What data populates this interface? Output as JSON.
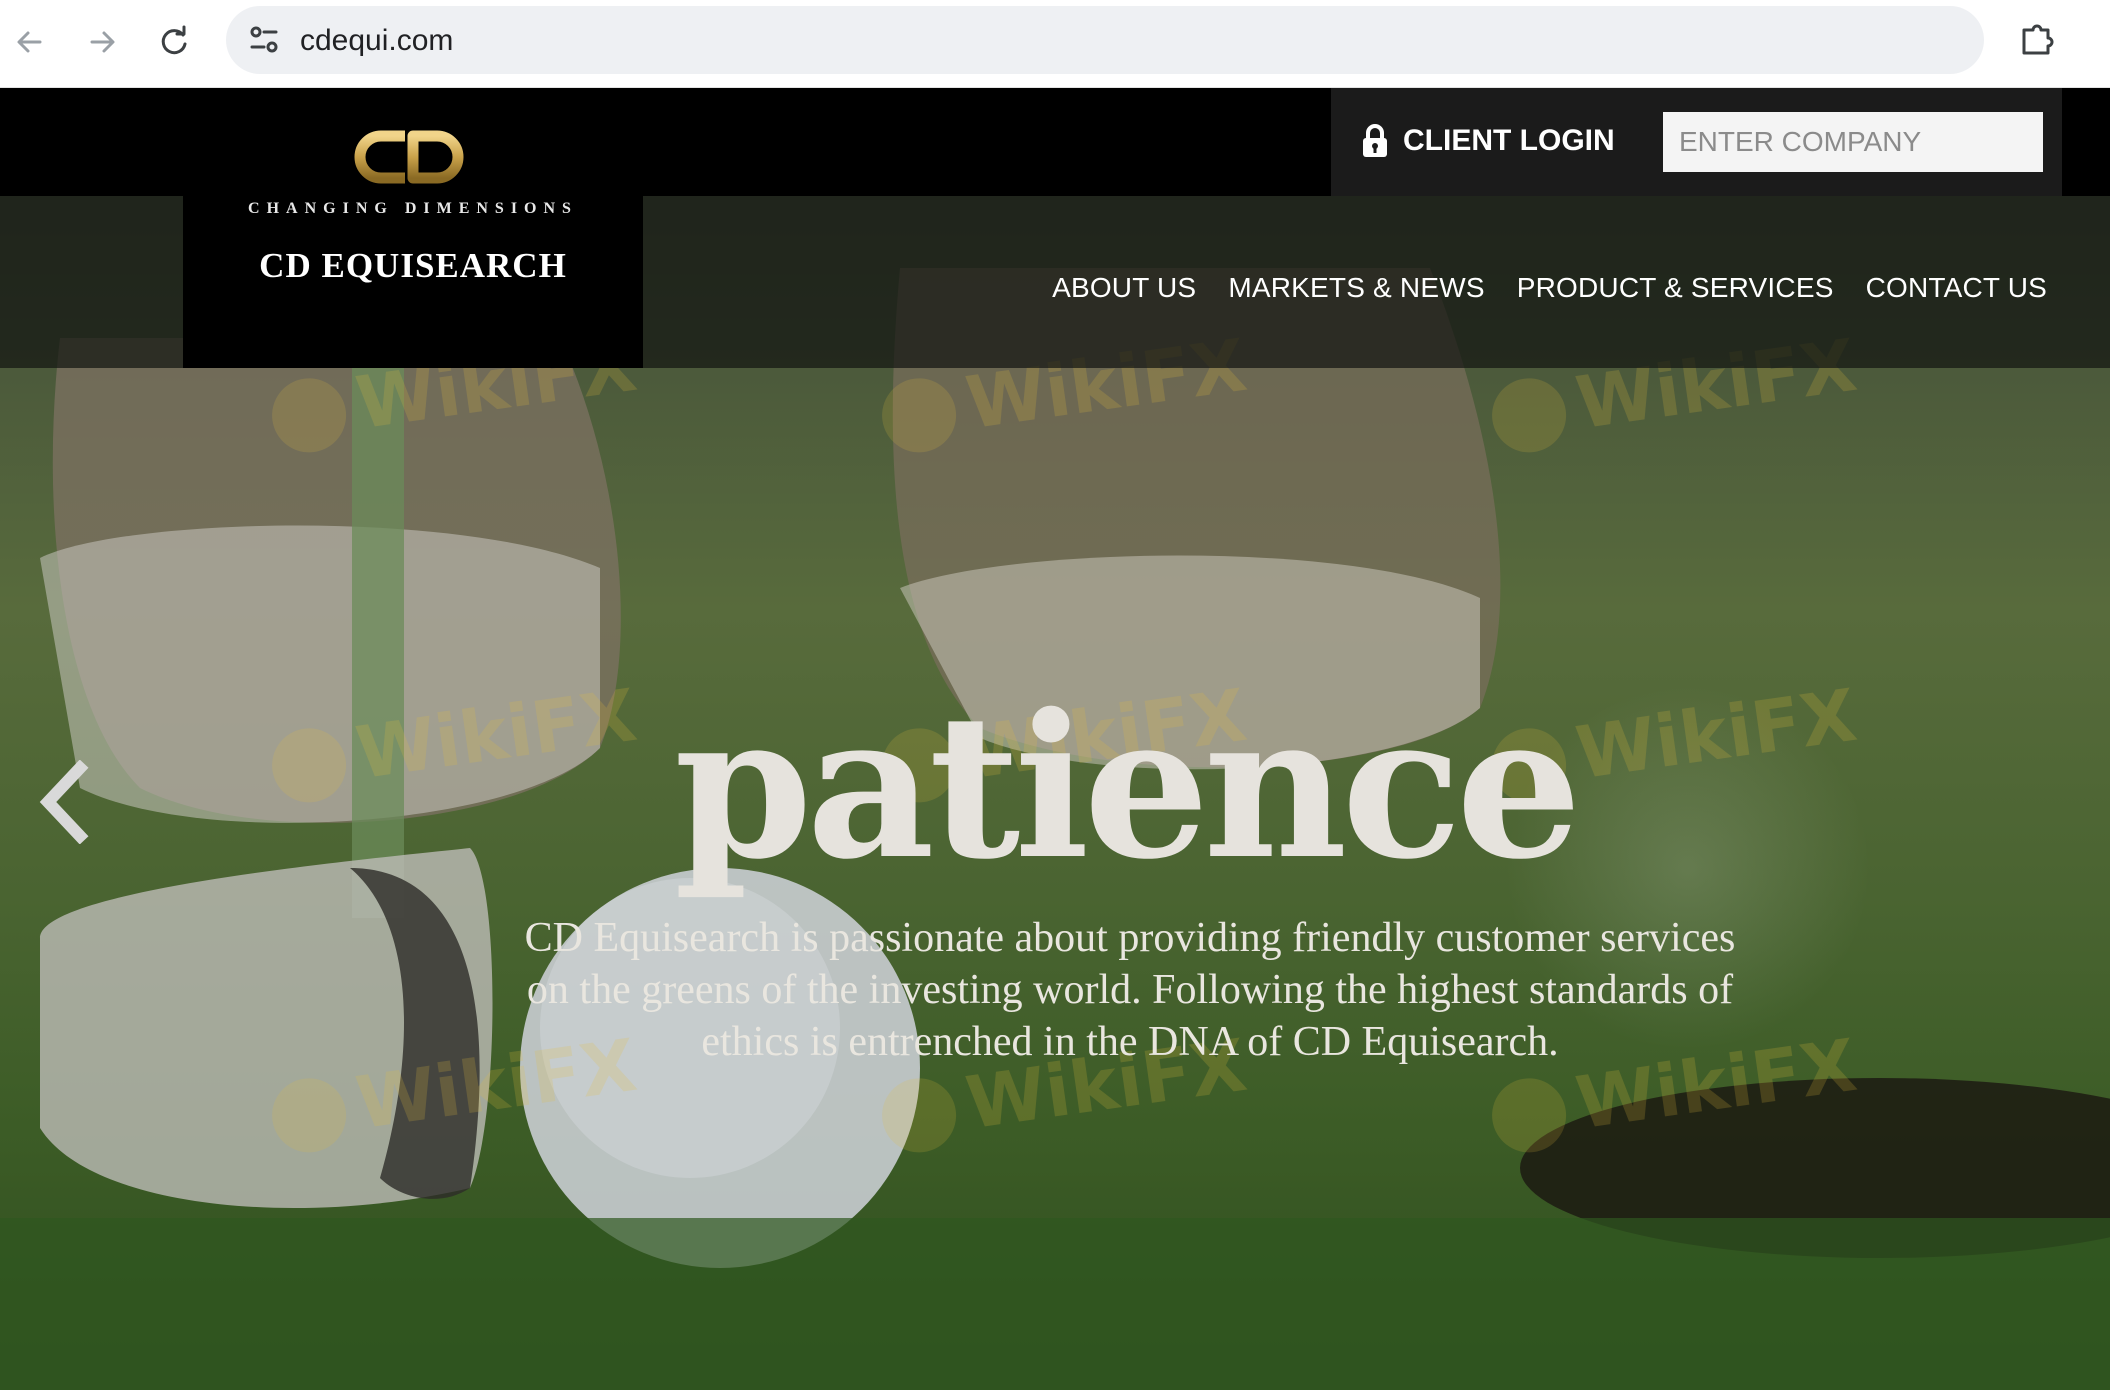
{
  "browser": {
    "url": "cdequi.com",
    "icons": [
      "back-arrow-icon",
      "forward-arrow-icon",
      "reload-icon",
      "site-info-icon",
      "star-icon",
      "extensions-icon"
    ]
  },
  "site": {
    "logo": {
      "monogram": "CD",
      "tagline": "CHANGING DIMENSIONS",
      "name": "CD EQUISEARCH"
    },
    "login": {
      "label": "CLIENT LOGIN",
      "company_placeholder": "ENTER COMPANY"
    },
    "nav": [
      {
        "label": "ABOUT US"
      },
      {
        "label": "MARKETS & NEWS"
      },
      {
        "label": "PRODUCT & SERVICES"
      },
      {
        "label": "CONTACT US"
      }
    ],
    "slider": {
      "headline": "patience",
      "text": "CD Equisearch is passionate about providing friendly customer services on the greens of the investing world. Following the highest standards of ethics is entrenched in the DNA of CD Equisearch."
    },
    "watermark": "WikiFX"
  },
  "colors": {
    "accent_gold": "#c9a24a",
    "topbar": "#000000",
    "login_panel": "#1b1b1b"
  }
}
